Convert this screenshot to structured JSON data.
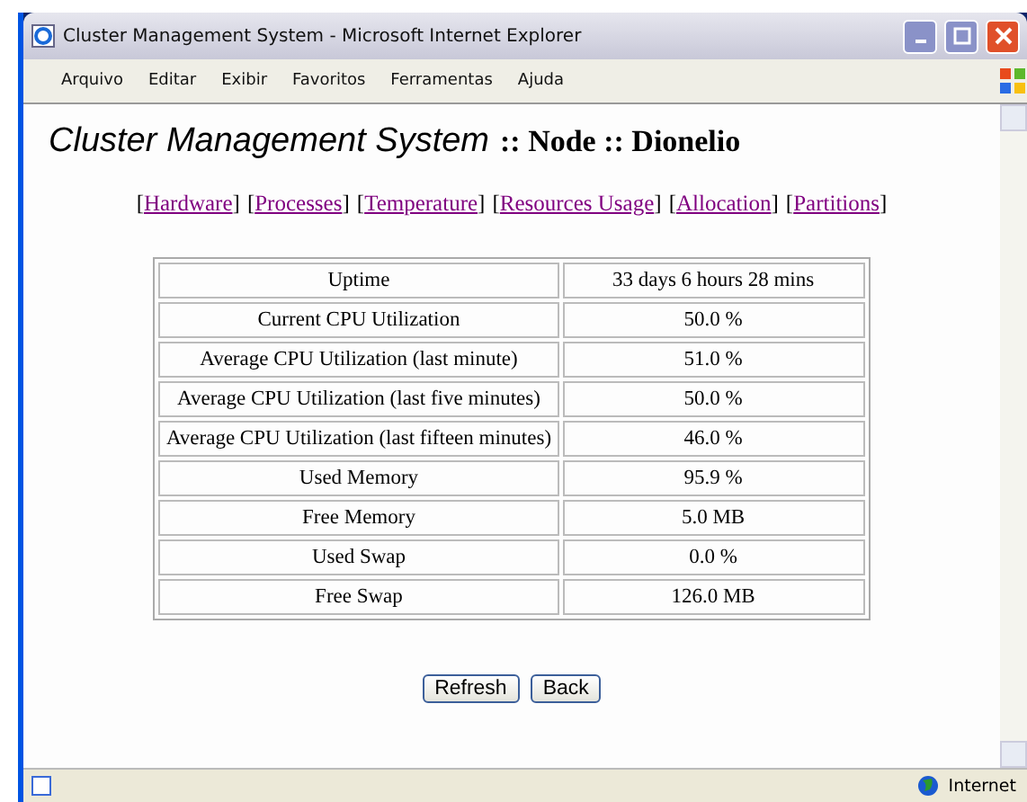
{
  "window": {
    "title": "Cluster Management System - Microsoft Internet Explorer"
  },
  "menu": [
    "Arquivo",
    "Editar",
    "Exibir",
    "Favoritos",
    "Ferramentas",
    "Ajuda"
  ],
  "heading": {
    "app": "Cluster Management System",
    "rest": ":: Node :: Dionelio"
  },
  "links": [
    {
      "open": "[",
      "label": "Hardware",
      "close": "]"
    },
    {
      "open": "[",
      "label": "Processes",
      "close": "]"
    },
    {
      "open": "[",
      "label": "Temperature",
      "close": "]"
    },
    {
      "open": "[",
      "label": "Resources Usage",
      "close": "]"
    },
    {
      "open": "[",
      "label": "Allocation",
      "close": "]"
    },
    {
      "open": "[",
      "label": "Partitions",
      "close": "]"
    }
  ],
  "table": {
    "rows": [
      {
        "label": "Uptime",
        "value": "33 days 6 hours 28 mins"
      },
      {
        "label": "Current CPU Utilization",
        "value": "50.0 %"
      },
      {
        "label": "Average CPU Utilization (last minute)",
        "value": "51.0 %"
      },
      {
        "label": "Average CPU Utilization (last five minutes)",
        "value": "50.0 %"
      },
      {
        "label": "Average CPU Utilization (last fifteen minutes)",
        "value": "46.0 %"
      },
      {
        "label": "Used Memory",
        "value": "95.9 %"
      },
      {
        "label": "Free Memory",
        "value": "5.0 MB"
      },
      {
        "label": "Used Swap",
        "value": "0.0 %"
      },
      {
        "label": "Free Swap",
        "value": "126.0 MB"
      }
    ]
  },
  "buttons": [
    "Refresh",
    "Back"
  ],
  "status_bar": {
    "zone": "Internet"
  }
}
